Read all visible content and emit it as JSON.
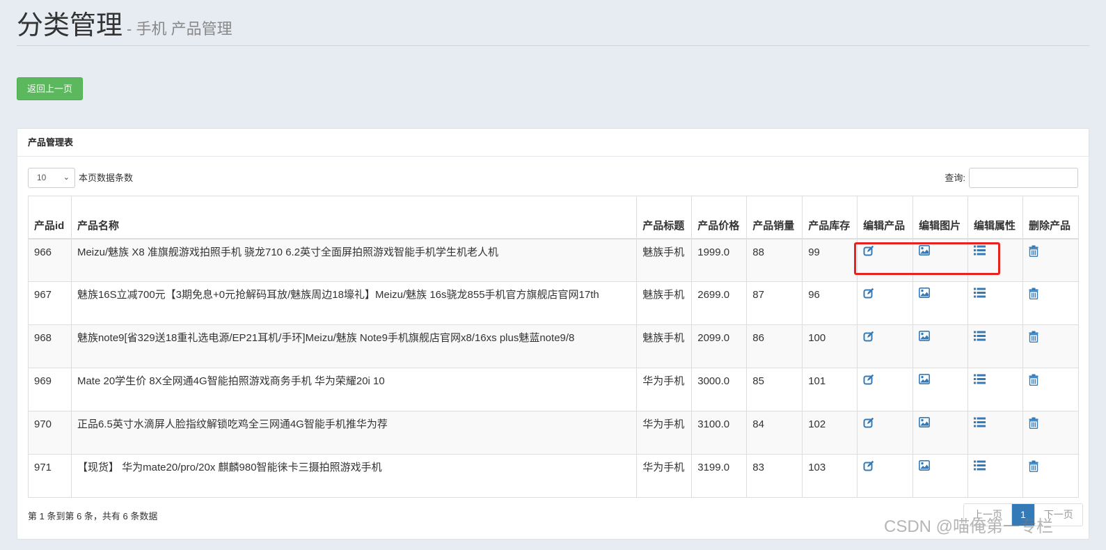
{
  "header": {
    "title": "分类管理",
    "subtitle": "- 手机 产品管理"
  },
  "back_button": {
    "label": "返回上一页"
  },
  "panel": {
    "title": "产品管理表",
    "page_length": {
      "value": "10",
      "label": "本页数据条数"
    },
    "search": {
      "label": "查询:",
      "value": ""
    },
    "columns": [
      "产品id",
      "产品名称",
      "产品标题",
      "产品价格",
      "产品销量",
      "产品库存",
      "编辑产品",
      "编辑图片",
      "编辑属性",
      "删除产品"
    ],
    "rows": [
      {
        "id": "966",
        "name": "Meizu/魅族 X8 准旗舰游戏拍照手机 骁龙710 6.2英寸全面屏拍照游戏智能手机学生机老人机",
        "title": "魅族手机",
        "price": "1999.0",
        "sales": "88",
        "stock": "99"
      },
      {
        "id": "967",
        "name": "魅族16S立减700元【3期免息+0元抢解码耳放/魅族周边18壕礼】Meizu/魅族 16s骁龙855手机官方旗舰店官网17th",
        "title": "魅族手机",
        "price": "2699.0",
        "sales": "87",
        "stock": "96"
      },
      {
        "id": "968",
        "name": "魅族note9[省329送18重礼选电源/EP21耳机/手环]Meizu/魅族 Note9手机旗舰店官网x8/16xs plus魅蓝note9/8",
        "title": "魅族手机",
        "price": "2099.0",
        "sales": "86",
        "stock": "100"
      },
      {
        "id": "969",
        "name": "Mate 20学生价 8X全网通4G智能拍照游戏商务手机 华为荣耀20i 10",
        "title": "华为手机",
        "price": "3000.0",
        "sales": "85",
        "stock": "101"
      },
      {
        "id": "970",
        "name": "正品6.5英寸水滴屏人脸指纹解锁吃鸡全三网通4G智能手机推华为荐",
        "title": "华为手机",
        "price": "3100.0",
        "sales": "84",
        "stock": "102"
      },
      {
        "id": "971",
        "name": "【现货】 华为mate20/pro/20x 麒麟980智能徕卡三摄拍照游戏手机",
        "title": "华为手机",
        "price": "3199.0",
        "sales": "83",
        "stock": "103"
      }
    ],
    "info": "第 1 条到第 6 条，共有 6 条数据",
    "pager": {
      "prev": "上一页",
      "current": "1",
      "next": "下一页"
    }
  },
  "icons": {
    "edit": "edit-icon",
    "image": "picture-icon",
    "attributes": "list-icon",
    "delete": "trash-icon"
  },
  "colors": {
    "accent": "#337ab7",
    "success": "#5cb85c",
    "highlight": "#e8231e"
  },
  "watermark": "CSDN @喵俺第一专栏"
}
